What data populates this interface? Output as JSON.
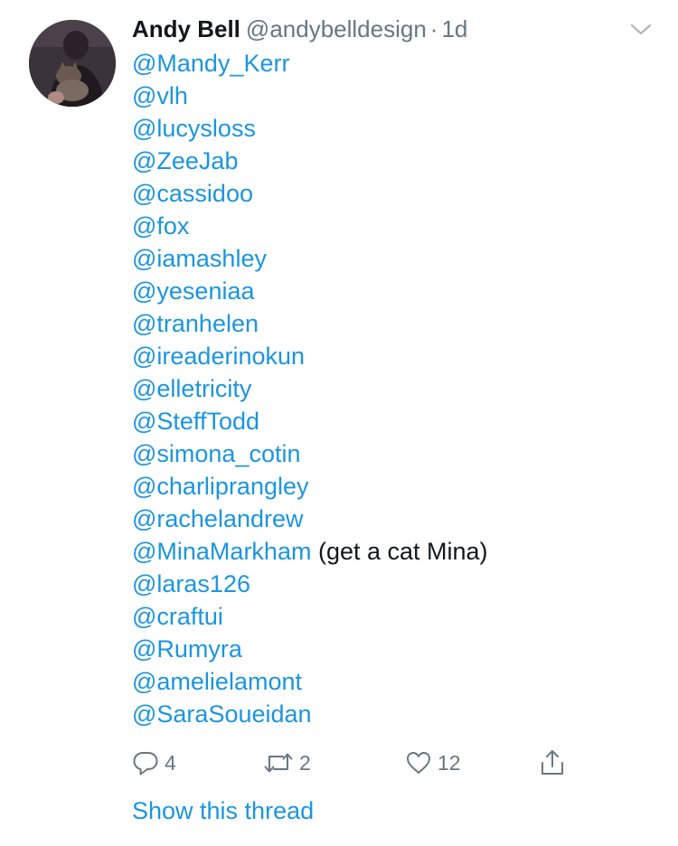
{
  "tweet": {
    "author": {
      "name": "Andy Bell",
      "handle": "@andybelldesign",
      "separator": "·",
      "timestamp": "1d"
    },
    "mentions": [
      {
        "handle": "@Mandy_Kerr",
        "note": ""
      },
      {
        "handle": "@vlh",
        "note": ""
      },
      {
        "handle": "@lucysloss",
        "note": ""
      },
      {
        "handle": "@ZeeJab",
        "note": ""
      },
      {
        "handle": "@cassidoo",
        "note": ""
      },
      {
        "handle": "@fox",
        "note": ""
      },
      {
        "handle": "@iamashley",
        "note": ""
      },
      {
        "handle": "@yeseniaa",
        "note": ""
      },
      {
        "handle": "@tranhelen",
        "note": ""
      },
      {
        "handle": "@ireaderinokun",
        "note": ""
      },
      {
        "handle": "@elletricity",
        "note": ""
      },
      {
        "handle": "@SteffTodd",
        "note": ""
      },
      {
        "handle": "@simona_cotin",
        "note": ""
      },
      {
        "handle": "@charliprangley",
        "note": ""
      },
      {
        "handle": "@rachelandrew",
        "note": ""
      },
      {
        "handle": "@MinaMarkham",
        "note": " (get a cat Mina)"
      },
      {
        "handle": "@laras126",
        "note": ""
      },
      {
        "handle": "@craftui",
        "note": ""
      },
      {
        "handle": "@Rumyra",
        "note": ""
      },
      {
        "handle": "@amelielamont",
        "note": ""
      },
      {
        "handle": "@SaraSoueidan",
        "note": ""
      }
    ],
    "actions": {
      "reply_count": "4",
      "retweet_count": "2",
      "like_count": "12"
    },
    "show_thread_label": "Show this thread"
  },
  "colors": {
    "link": "#1b95e0",
    "text": "#14171a",
    "secondary": "#657786"
  },
  "icons": {
    "caret": "chevron-down-icon",
    "reply": "reply-icon",
    "retweet": "retweet-icon",
    "like": "heart-icon",
    "share": "share-icon"
  }
}
